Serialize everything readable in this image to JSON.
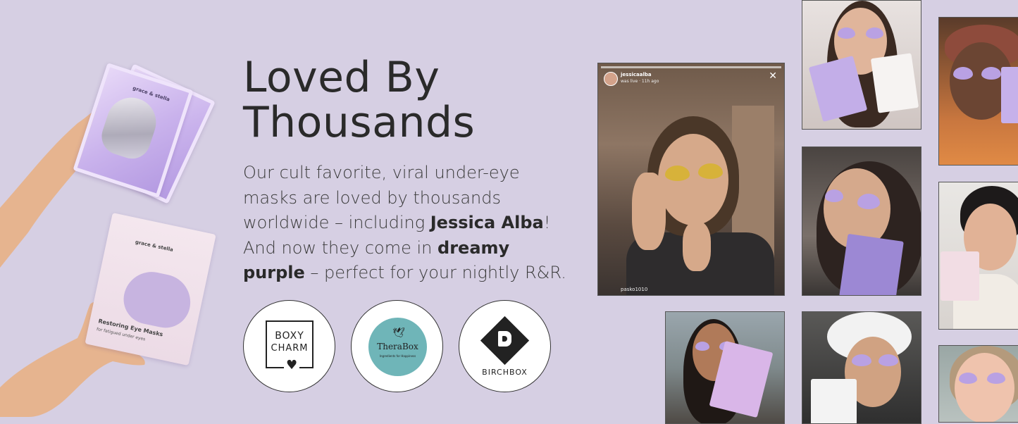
{
  "heading": {
    "line1": "Loved By",
    "line2": "Thousands"
  },
  "body": {
    "part1": "Our cult favorite, viral under-eye masks are loved by thousands worldwide – including ",
    "bold1": "Jessica Alba",
    "part2": "! And now they come in ",
    "bold2": "dreamy purple",
    "part3": " – perfect for your nightly R&R."
  },
  "partners": {
    "boxycharm": {
      "line1": "BOXY",
      "line2": "CHARM",
      "icon": "heart-icon"
    },
    "therabox": {
      "word": "TheraBox",
      "tagline": "Ingredients for Happiness",
      "icon": "bird-icon"
    },
    "birchbox": {
      "word": "BIRCHBOX"
    }
  },
  "product": {
    "sachet_brand": "grace & stella",
    "box_brand": "grace & stella",
    "box_title": "Restoring Eye Masks",
    "box_subtitle": "for fatigued under eyes"
  },
  "live_post": {
    "username": "jessicaalba",
    "status": "was live · 11h ago",
    "commenter": "pasko1010",
    "close_icon": "close-icon"
  },
  "colors": {
    "background": "#d6cfe3",
    "text": "#2a2a2a",
    "thera_teal": "#6fb5b8",
    "mask_purple": "#b9a1e3",
    "mask_gold": "#d7b23a"
  }
}
